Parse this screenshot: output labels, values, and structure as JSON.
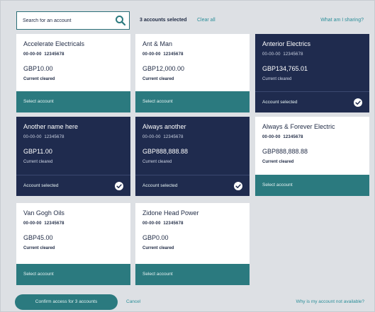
{
  "search": {
    "placeholder": "Search for an account",
    "value": ""
  },
  "header": {
    "selected_count": "3 accounts selected",
    "clear_all": "Clear all",
    "what_sharing": "What am I sharing?"
  },
  "accounts": [
    {
      "name": "Accelerate Electricals",
      "sort_code": "00-00-00",
      "account_number": "12345678",
      "balance": "GBP10.00",
      "status": "Current cleared",
      "action": "Select account",
      "selected": false
    },
    {
      "name": "Ant & Man",
      "sort_code": "00-00-00",
      "account_number": "12345678",
      "balance": "GBP12,000.00",
      "status": "Current cleared",
      "action": "Select account",
      "selected": false
    },
    {
      "name": "Anterior Electrics",
      "sort_code": "00-00-00",
      "account_number": "12345678",
      "balance": "GBP134,765.01",
      "status": "Current cleared",
      "action": "Account selected",
      "selected": true
    },
    {
      "name": "Another name here",
      "sort_code": "00-00-00",
      "account_number": "12345678",
      "balance": "GBP11.00",
      "status": "Current cleared",
      "action": "Account selected",
      "selected": true
    },
    {
      "name": "Always another",
      "sort_code": "00-00-00",
      "account_number": "12345678",
      "balance": "GBP888,888.88",
      "status": "Current cleared",
      "action": "Account selected",
      "selected": true
    },
    {
      "name": "Always & Forever Electric",
      "sort_code": "00-00-00",
      "account_number": "12345678",
      "balance": "GBP888,888.88",
      "status": "Current cleared",
      "action": "Select account",
      "selected": false
    },
    {
      "name": "Van Gogh Oils",
      "sort_code": "00-00-00",
      "account_number": "12345678",
      "balance": "GBP45.00",
      "status": "Current cleared",
      "action": "Select account",
      "selected": false
    },
    {
      "name": "Zidone Head Power",
      "sort_code": "00-00-00",
      "account_number": "12345678",
      "balance": "GBP0.00",
      "status": "Current cleared",
      "action": "Select account",
      "selected": false
    }
  ],
  "footer": {
    "confirm_label": "Confirm access for 3 accounts",
    "cancel_label": "Cancel",
    "why_label": "Why is my account not available?"
  },
  "icons": {
    "search": "search-icon",
    "check": "check-icon"
  },
  "colors": {
    "teal": "#2b7a7f",
    "navy": "#1f2b4e",
    "link": "#2b8e99",
    "background": "#dde0e4"
  }
}
